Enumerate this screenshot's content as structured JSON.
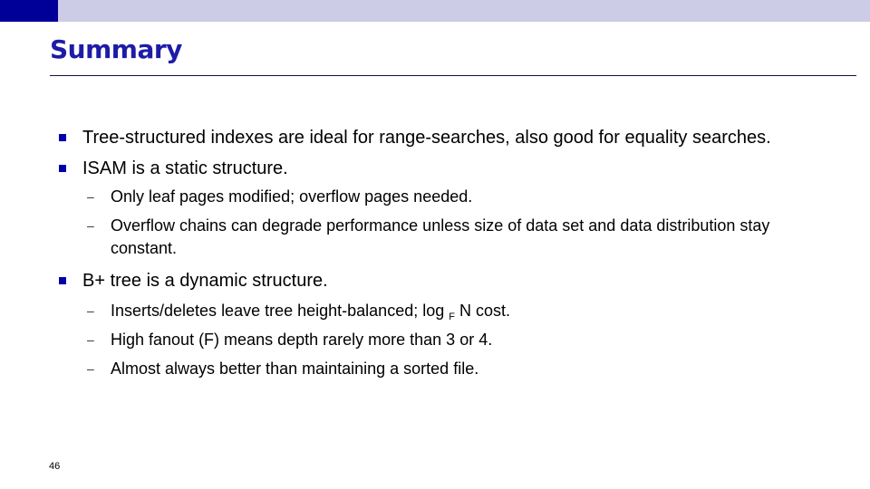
{
  "slide": {
    "title": "Summary",
    "page_number": "46",
    "colors": {
      "title": "#1C1CA8",
      "bullet": "#0000A8",
      "topbar": "#CCCCE6",
      "topbar_block": "#000099"
    },
    "bullets": [
      {
        "text": "Tree-structured indexes are ideal for range-searches, also good for equality searches.",
        "subitems": []
      },
      {
        "text": "ISAM is a static structure.",
        "subitems": [
          {
            "text": "Only leaf pages modified; overflow pages needed."
          },
          {
            "text": "Overflow chains can degrade performance unless size of data set and data distribution stay constant."
          }
        ]
      },
      {
        "text": "B+ tree is a dynamic structure.",
        "subitems": [
          {
            "text_before": "Inserts/deletes leave tree height-balanced; log ",
            "subscript": "F",
            "text_after": " N cost."
          },
          {
            "text": "High fanout (F) means depth rarely more than 3 or 4."
          },
          {
            "text": "Almost always better than maintaining a sorted file."
          }
        ]
      }
    ],
    "sub_marker": "–"
  }
}
